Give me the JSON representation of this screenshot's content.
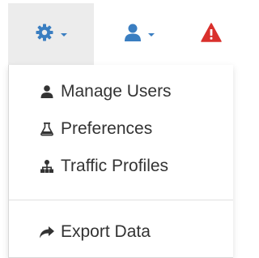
{
  "navbar": {
    "settings": {
      "icon": "gear-icon",
      "color": "#3a7ec1",
      "active": true
    },
    "user": {
      "icon": "user-icon",
      "color": "#3a7ec1"
    },
    "alert": {
      "icon": "warning-icon",
      "color": "#d9302c"
    }
  },
  "menu": {
    "items": [
      {
        "label": "Manage Users",
        "icon": "users-icon"
      },
      {
        "label": "Preferences",
        "icon": "flask-icon"
      },
      {
        "label": "Traffic Profiles",
        "icon": "sitemap-icon"
      },
      {
        "label": "Export Data",
        "icon": "share-arrow-icon"
      }
    ]
  }
}
